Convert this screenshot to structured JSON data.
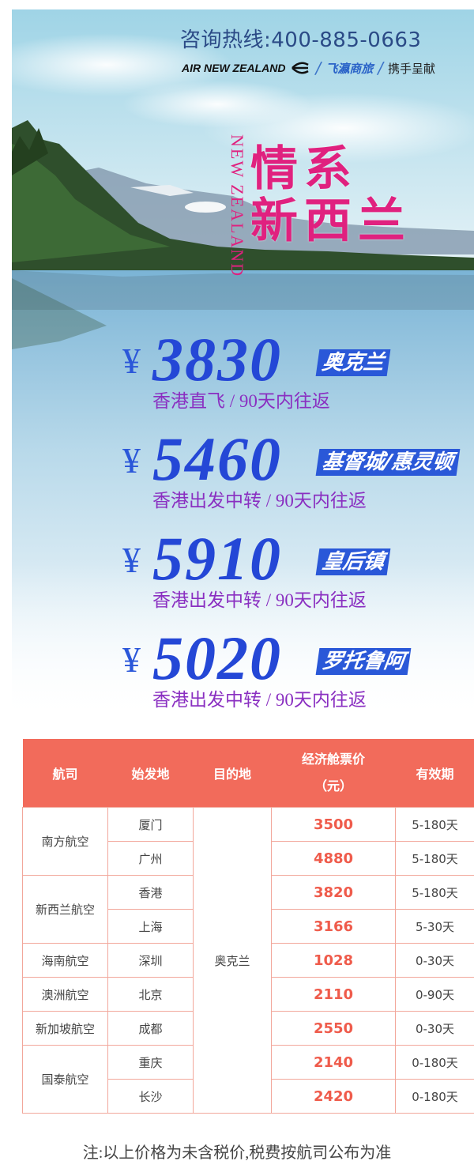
{
  "header": {
    "hotline": "咨询热线:400-885-0663",
    "airline": "AIR NEW ZEALAND",
    "airline_icon": "koru-icon",
    "partner": "飞瀛商旅",
    "cosponsor": "携手呈献"
  },
  "title": {
    "vertical_en": "NEW ZEALAND",
    "line1": "情系",
    "line2": "新西兰",
    "color": "#e0217f"
  },
  "offers": [
    {
      "currency": "¥",
      "price": "3830",
      "destination": "奥克兰",
      "route": "香港直飞 / 90天内往返"
    },
    {
      "currency": "¥",
      "price": "5460",
      "destination": "基督城/惠灵顿",
      "route": "香港出发中转 / 90天内往返"
    },
    {
      "currency": "¥",
      "price": "5910",
      "destination": "皇后镇",
      "route": "香港出发中转 / 90天内往返"
    },
    {
      "currency": "¥",
      "price": "5020",
      "destination": "罗托鲁阿",
      "route": "香港出发中转 / 90天内往返"
    }
  ],
  "table": {
    "headers": {
      "airline": "航司",
      "origin": "始发地",
      "destination": "目的地",
      "price_line1": "经济舱票价",
      "price_line2": "（元）",
      "validity": "有效期"
    },
    "destination": "奥克兰",
    "airlines": [
      "南方航空",
      "新西兰航空",
      "海南航空",
      "澳洲航空",
      "新加坡航空",
      "国泰航空"
    ],
    "rows": [
      {
        "origin": "厦门",
        "price": "3500",
        "validity": "5-180天"
      },
      {
        "origin": "广州",
        "price": "4880",
        "validity": "5-180天"
      },
      {
        "origin": "香港",
        "price": "3820",
        "validity": "5-180天"
      },
      {
        "origin": "上海",
        "price": "3166",
        "validity": "5-30天"
      },
      {
        "origin": "深圳",
        "price": "1028",
        "validity": "0-30天"
      },
      {
        "origin": "北京",
        "price": "2110",
        "validity": "0-90天"
      },
      {
        "origin": "成都",
        "price": "2550",
        "validity": "0-30天"
      },
      {
        "origin": "重庆",
        "price": "2140",
        "validity": "0-180天"
      },
      {
        "origin": "长沙",
        "price": "2420",
        "validity": "0-180天"
      }
    ]
  },
  "note": "注:以上价格为未含税价,税费按航司公布为准",
  "colors": {
    "price_blue": "#2447d6",
    "dest_badge": "#2a58d8",
    "route_purple": "#8a2fc1",
    "table_header": "#f26b5b",
    "table_border": "#f2a79b"
  }
}
